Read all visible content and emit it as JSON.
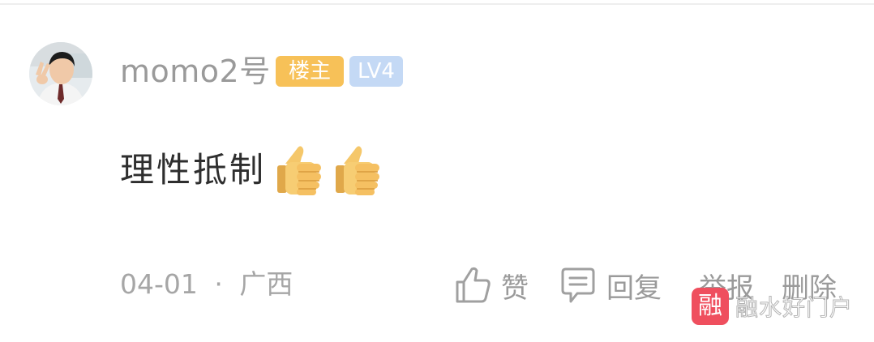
{
  "comment": {
    "username": "momo2号",
    "badges": {
      "host": "楼主",
      "level": "LV4"
    },
    "text": "理性抵制",
    "emojis": [
      "thumbs-up-emoji",
      "thumbs-up-emoji"
    ],
    "date": "04-01",
    "separator": "·",
    "location": "广西"
  },
  "actions": {
    "like_label": "赞",
    "reply_label": "回复",
    "report_label": "举报",
    "delete_label": "删除"
  },
  "watermark": {
    "logo_char": "融",
    "text": "融水好门户"
  },
  "colors": {
    "username": "#9a9a9a",
    "host_badge": "#f7c158",
    "level_badge": "#c4d9f5",
    "content_text": "#2e2e2e",
    "meta_text": "#a6a6a6",
    "watermark_logo": "#ef4f5e"
  }
}
